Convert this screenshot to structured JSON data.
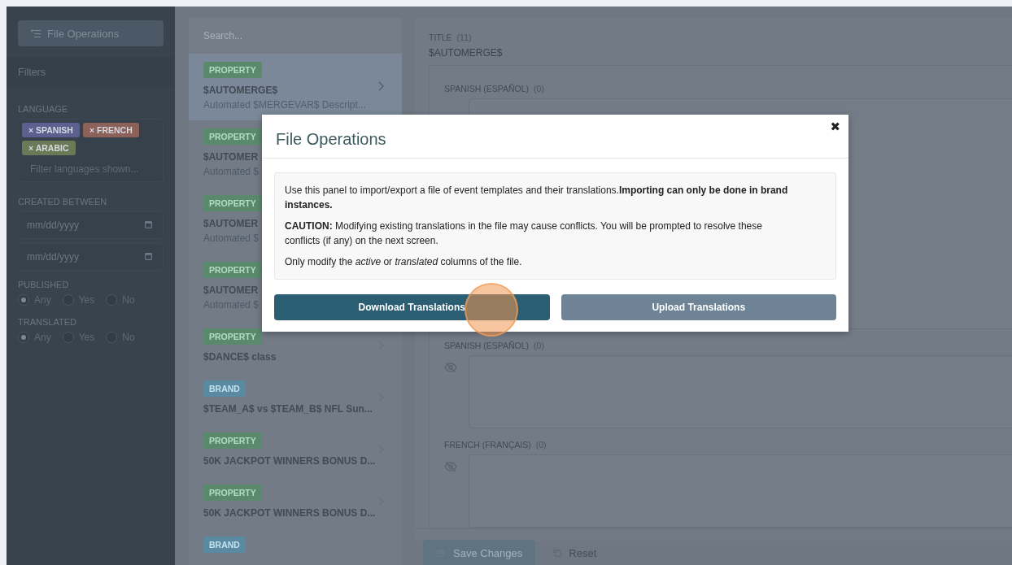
{
  "sidebar": {
    "file_operations_button": "File Operations",
    "filters_title": "Filters",
    "language": {
      "label": "LANGUAGE",
      "tags": [
        {
          "label": "× SPANISH",
          "color": "#5d5f8f"
        },
        {
          "label": "× FRENCH",
          "color": "#8b6159"
        },
        {
          "label": "× ARABIC",
          "color": "#6a7a57"
        }
      ],
      "placeholder": "Filter languages shown..."
    },
    "created_between": {
      "label": "CREATED BETWEEN",
      "fields": [
        {
          "placeholder": "mm/dd/yyyy"
        },
        {
          "placeholder": "mm/dd/yyyy"
        }
      ]
    },
    "radio_groups": [
      {
        "label": "PUBLISHED",
        "options": [
          {
            "label": "Any",
            "selected": true
          },
          {
            "label": "Yes",
            "selected": false
          },
          {
            "label": "No",
            "selected": false
          }
        ]
      },
      {
        "label": "TRANSLATED",
        "options": [
          {
            "label": "Any",
            "selected": true
          },
          {
            "label": "Yes",
            "selected": false
          },
          {
            "label": "No",
            "selected": false
          }
        ]
      }
    ]
  },
  "list": {
    "search_placeholder": "Search...",
    "items": [
      {
        "kind": "property",
        "tag": "PROPERTY",
        "title": "$AUTOMERGE$",
        "subtitle": "Automated $MERGEVAR$ Descript...",
        "selected": true
      },
      {
        "kind": "property",
        "tag": "PROPERTY",
        "title": "$AUTOMER",
        "subtitle": "Automated $",
        "selected": false
      },
      {
        "kind": "property",
        "tag": "PROPERTY",
        "title": "$AUTOMER",
        "subtitle": "Automated $",
        "selected": false
      },
      {
        "kind": "property",
        "tag": "PROPERTY",
        "title": "$AUTOMER",
        "subtitle": "Automated $",
        "selected": false
      },
      {
        "kind": "property",
        "tag": "PROPERTY",
        "title": "$DANCE$ class",
        "selected": false
      },
      {
        "kind": "brand",
        "tag": "BRAND",
        "title": "$TEAM_A$ vs $TEAM_B$ NFL Sun...",
        "selected": false
      },
      {
        "kind": "property",
        "tag": "PROPERTY",
        "title": "50K JACKPOT WINNERS BONUS D...",
        "selected": false
      },
      {
        "kind": "property",
        "tag": "PROPERTY",
        "title": "50K JACKPOT WINNERS BONUS D...",
        "selected": false
      },
      {
        "kind": "brand",
        "tag": "BRAND",
        "selected": false
      }
    ]
  },
  "detail": {
    "title_label": "TITLE",
    "title_count": "(11)",
    "title_value": "$AUTOMERGE$",
    "top_translation": {
      "label": "SPANISH (ESPAÑOL)",
      "count": "(0)"
    },
    "translations": [
      {
        "label": "SPANISH (ESPAÑOL)",
        "count": "(0)"
      },
      {
        "label": "FRENCH (FRANÇAIS)",
        "count": "(0)"
      }
    ],
    "save_button": "Save Changes",
    "reset_button": "Reset"
  },
  "modal": {
    "title": "File Operations",
    "close": "✖",
    "paragraphs": [
      "Use this panel to import/export a file of event templates and their translations.**Importing can only be done in brand instances.**",
      "**CAUTION:** Modifying existing translations in the file may cause conflicts. You will be prompted to resolve these conflicts (if any) on the next screen.",
      "Only modify the *active* or *translated* columns of the file."
    ],
    "buttons": [
      {
        "kind": "primary",
        "label": "Download Translations"
      },
      {
        "kind": "secondary",
        "label": "Upload Translations"
      }
    ]
  }
}
